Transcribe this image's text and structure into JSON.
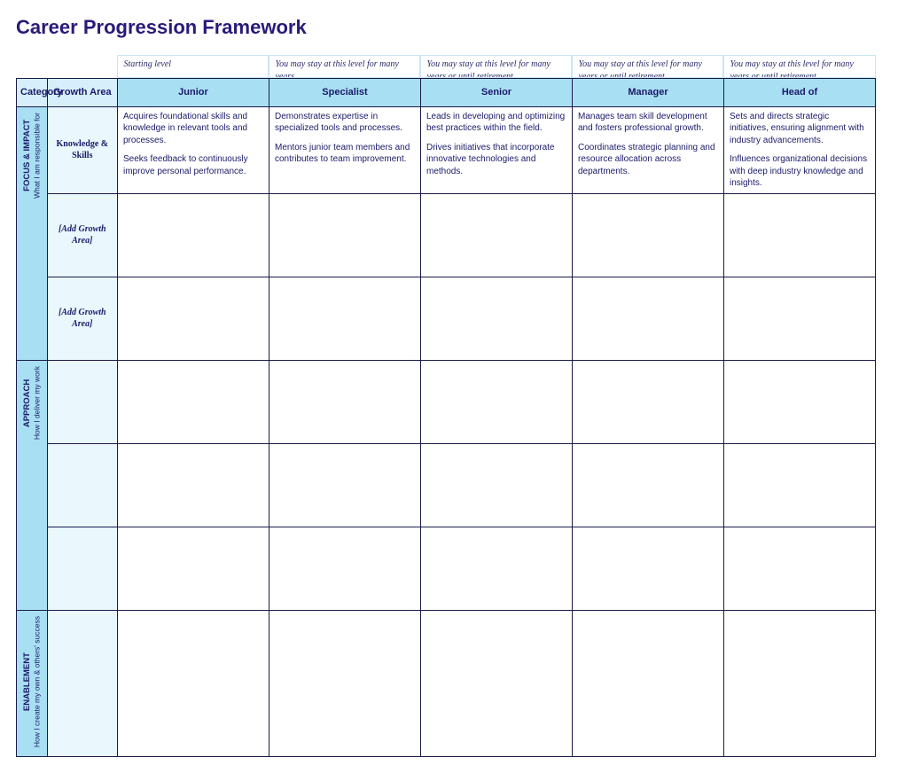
{
  "title": "Career Progression Framework",
  "level_notes": [
    "Starting level",
    "You may stay at this level for many years",
    "You may stay at this level for many years or until retirement",
    "You may stay at this level for many years or until retirement",
    "You may stay at this level for many years or until retirement"
  ],
  "header": {
    "category": "Category",
    "growth_area": "Growth Area",
    "levels": [
      "Junior",
      "Specialist",
      "Senior",
      "Manager",
      "Head of"
    ]
  },
  "categories": [
    {
      "title": "FOCUS & IMPACT",
      "subtitle": "What I am responsible for"
    },
    {
      "title": "APPROACH",
      "subtitle": "How I deliver my work"
    },
    {
      "title": "ENABLEMENT",
      "subtitle": "How I create my own & others' success"
    }
  ],
  "growth_areas": {
    "knowledge": "Knowledge & Skills",
    "placeholder": "[Add Growth Area]"
  },
  "cells": {
    "knowledge": {
      "junior": {
        "p1": "Acquires foundational skills and knowledge in relevant tools and processes.",
        "p2": "Seeks feedback to continuously improve personal performance."
      },
      "specialist": {
        "p1": "Demonstrates expertise in specialized tools and processes.",
        "p2": "Mentors junior team members and contributes to team improvement."
      },
      "senior": {
        "p1": "Leads in developing and optimizing best practices within the field.",
        "p2": "Drives initiatives that incorporate innovative technologies and methods."
      },
      "manager": {
        "p1": "Manages team skill development and fosters professional growth.",
        "p2": "Coordinates strategic planning and resource allocation across departments."
      },
      "head": {
        "p1": "Sets and directs strategic initiatives, ensuring alignment with industry advancements.",
        "p2": "Influences organizational decisions with deep industry knowledge and insights."
      }
    }
  }
}
